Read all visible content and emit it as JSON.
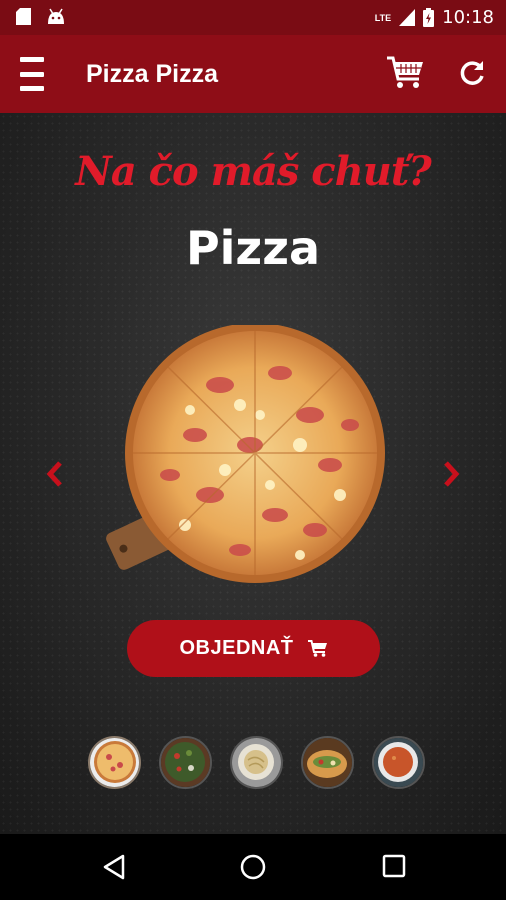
{
  "status_bar": {
    "time": "10:18",
    "network": "LTE"
  },
  "app_bar": {
    "title": "Pizza Pizza"
  },
  "hero": {
    "tagline": "Na čo máš chuť?",
    "category": "Pizza"
  },
  "order_button": {
    "label": "OBJEDNAŤ"
  },
  "thumbnails": [
    {
      "name": "pizza",
      "active": true
    },
    {
      "name": "salad",
      "active": false
    },
    {
      "name": "pasta",
      "active": false
    },
    {
      "name": "wrap",
      "active": false
    },
    {
      "name": "soup",
      "active": false
    }
  ],
  "colors": {
    "accent": "#b01019",
    "app_bar": "#8e0d17",
    "status_bar": "#7a0c14",
    "tagline": "#e11b2a"
  }
}
